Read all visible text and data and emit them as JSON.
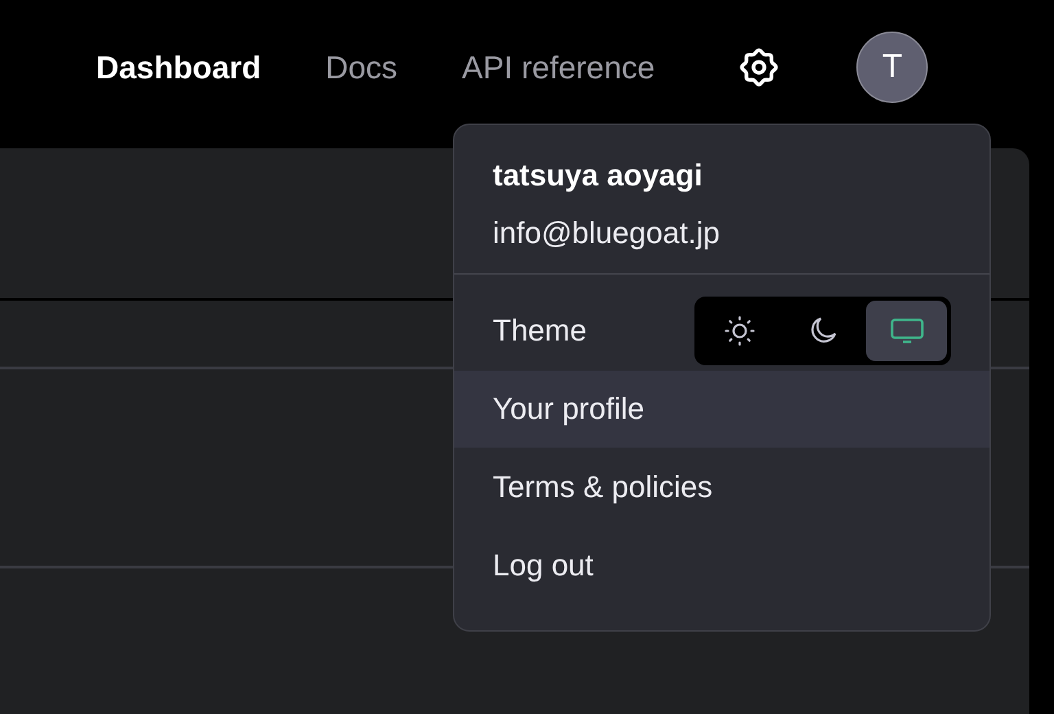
{
  "nav": {
    "links": [
      {
        "label": "Dashboard",
        "selected": true
      },
      {
        "label": "Docs",
        "selected": false
      },
      {
        "label": "API reference",
        "selected": false
      }
    ],
    "avatar": "T"
  },
  "menu": {
    "name": "tatsuya aoyagi",
    "email": "info@bluegoat.jp",
    "theme": {
      "label": "Theme",
      "options": [
        {
          "kind": "light",
          "selected": false
        },
        {
          "kind": "dark",
          "selected": false
        },
        {
          "kind": "system",
          "selected": true
        }
      ]
    },
    "items": [
      {
        "label": "Your profile",
        "hovered": true
      },
      {
        "label": "Terms & policies",
        "hovered": false
      },
      {
        "label": "Log out",
        "hovered": false
      }
    ]
  }
}
